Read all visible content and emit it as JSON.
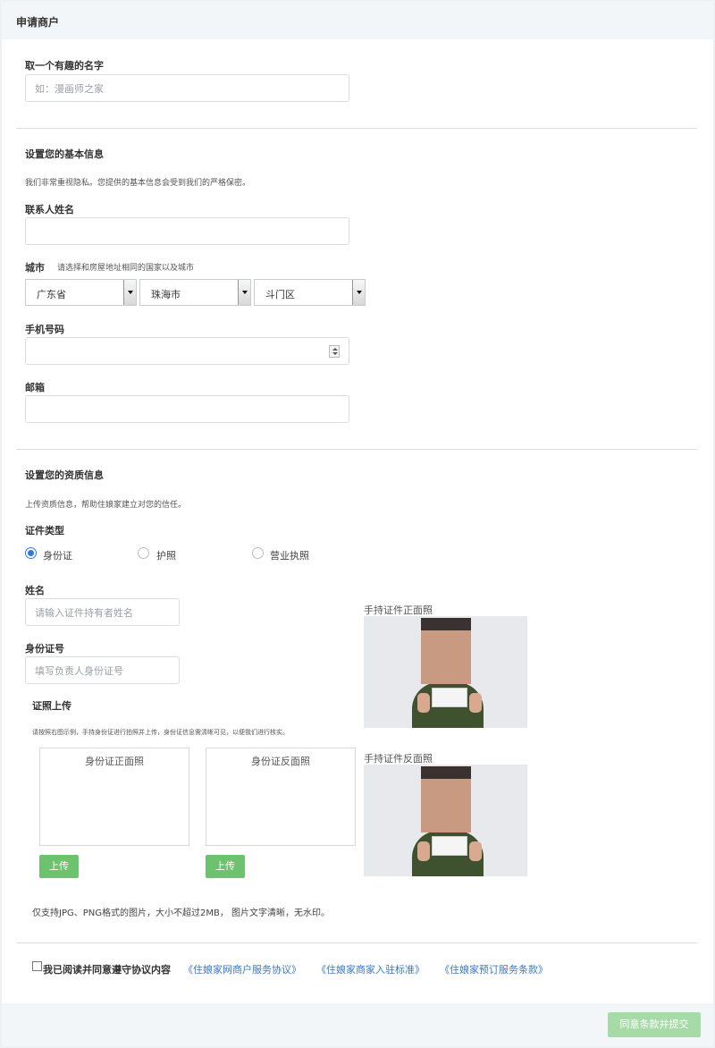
{
  "header": {
    "title": "申请商户"
  },
  "name_section": {
    "label": "取一个有趣的名字",
    "placeholder": "如：漫画师之家"
  },
  "basic": {
    "heading": "设置您的基本信息",
    "note": "我们非常重视隐私。您提供的基本信息会受到我们的严格保密。",
    "contact_label": "联系人姓名",
    "city_label": "城市",
    "city_hint": "请选择和房屋地址相同的国家以及城市",
    "province": "广东省",
    "city": "珠海市",
    "district": "斗门区",
    "phone_label": "手机号码",
    "email_label": "邮箱"
  },
  "qualification": {
    "heading": "设置您的资质信息",
    "note": "上传资质信息，帮助住娘家建立对您的信任。",
    "doc_type_label": "证件类型",
    "doc_types": [
      "身份证",
      "护照",
      "营业执照"
    ],
    "selected_doc_type": "身份证",
    "name_label": "姓名",
    "name_placeholder": "请输入证件持有者姓名",
    "id_label": "身份证号",
    "id_placeholder": "填写负责人身份证号",
    "upload_heading": "证照上传",
    "upload_note": "请按照右图示例，手持身份证进行拍照并上传，身份证信息需清晰可见，以便我们进行核实。",
    "front_box": "身份证正面照",
    "back_box": "身份证反面照",
    "upload_button": "上传",
    "sample_front_label": "手持证件正面照",
    "sample_back_label": "手持证件反面照",
    "format_note": "仅支持JPG、PNG格式的图片，大小不超过2MB， 图片文字清晰，无水印。"
  },
  "agreement": {
    "text": "我已阅读并同意遵守协议内容",
    "links": [
      "《住娘家网商户服务协议》",
      "《住娘家商家入驻标准》",
      "《住娘家预订服务条款》"
    ]
  },
  "footer": {
    "submit": "同意条款并提交"
  },
  "colors": {
    "accent": "#2d7be0",
    "upload_green": "#6dc26f",
    "submit_green": "#a6dba7",
    "link_blue": "#3a78c4"
  }
}
